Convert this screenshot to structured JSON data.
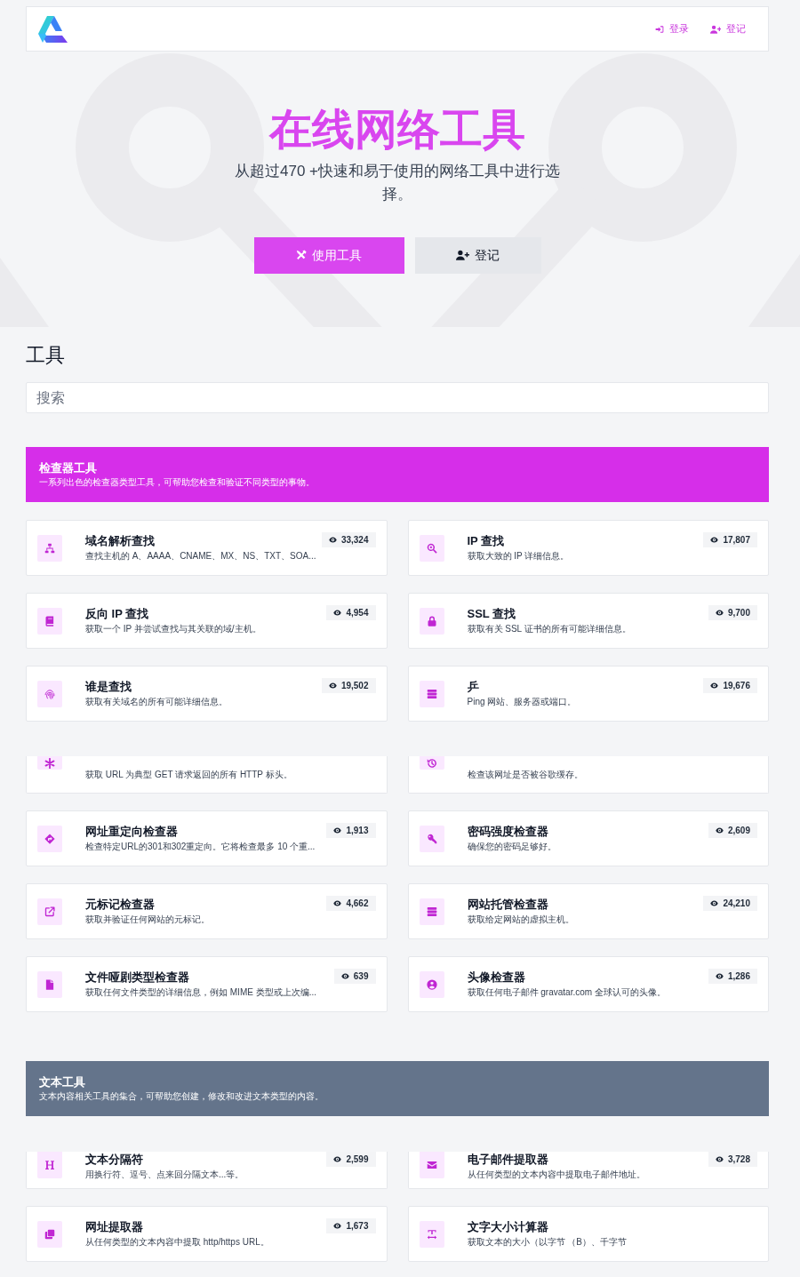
{
  "navbar": {
    "links": [
      {
        "label": "登录"
      },
      {
        "label": "登记"
      }
    ]
  },
  "hero": {
    "title": "在线网络工具",
    "subtitle": "从超过470 +快速和易于使用的网络工具中进行选择。",
    "buttons": [
      {
        "label": "使用工具",
        "kind": "primary"
      },
      {
        "label": "登记",
        "kind": "secondary"
      }
    ]
  },
  "tools": {
    "heading": "工具",
    "search": {
      "placeholder": "搜索"
    }
  },
  "categories": [
    {
      "title": "检查器工具",
      "description": "一系列出色的检查器类型工具，可帮助您检查和验证不同类型的事物。",
      "color": "#d62ee9",
      "tools": [
        {
          "title": "域名解析查找",
          "description": "查找主机的 A、AAAA、CNAME、MX、NS、TXT、SOA...",
          "views": "33,324",
          "cut_top": false
        },
        {
          "title": "IP 查找",
          "description": "获取大致的 IP 详细信息。",
          "views": "17,807",
          "cut_top": false
        },
        {
          "title": "反向 IP 查找",
          "description": "获取一个 IP 并尝试查找与其关联的域/主机。",
          "views": "4,954",
          "cut_top": false
        },
        {
          "title": "SSL 查找",
          "description": "获取有关 SSL 证书的所有可能详细信息。",
          "views": "9,700",
          "cut_top": false
        },
        {
          "title": "谁是查找",
          "description": "获取有关域名的所有可能详细信息。",
          "views": "19,502",
          "cut_top": false
        },
        {
          "title": "乒",
          "description": "Ping 网站、服务器或端口。",
          "views": "19,676",
          "cut_top": false
        },
        {
          "description": "获取 URL 为典型 GET 请求返回的所有 HTTP 标头。",
          "cut_top": true
        },
        {
          "description": "检查该网址是否被谷歌缓存。",
          "cut_top": true
        },
        {
          "title": "网址重定向检查器",
          "description": "检查特定URL的301和302重定向。它将检查最多 10 个重...",
          "views": "1,913",
          "cut_top": false
        },
        {
          "title": "密码强度检查器",
          "description": "确保您的密码足够好。",
          "views": "2,609",
          "cut_top": false
        },
        {
          "title": "元标记检查器",
          "description": "获取并验证任何网站的元标记。",
          "views": "4,662",
          "cut_top": false
        },
        {
          "title": "网站托管检查器",
          "description": "获取给定网站的虚拟主机。",
          "views": "24,210",
          "cut_top": false
        },
        {
          "title": "文件哑剧类型检查器",
          "description": "获取任何文件类型的详细信息，例如 MIME 类型或上次编...",
          "views": "639",
          "cut_top": false
        },
        {
          "title": "头像检查器",
          "description": "获取任何电子邮件 gravatar.com 全球认可的头像。",
          "views": "1,286",
          "cut_top": false
        }
      ]
    },
    {
      "title": "文本工具",
      "description": "文本内容相关工具的集合，可帮助您创建，修改和改进文本类型的内容。",
      "color": "#64748b",
      "tools": [
        {
          "title": "文本分隔符",
          "description": "用换行符、逗号、点来回分隔文本...等。",
          "views": "2,599",
          "cut_top": true
        },
        {
          "title": "电子邮件提取器",
          "description": "从任何类型的文本内容中提取电子邮件地址。",
          "views": "3,728",
          "cut_top": true
        },
        {
          "title": "网址提取器",
          "description": "从任何类型的文本内容中提取 http/https URL。",
          "views": "1,673",
          "cut_top": false
        },
        {
          "title": "文字大小计算器",
          "description": "获取文本的大小（以字节 （B）、千字节",
          "cut_top": false
        }
      ]
    }
  ]
}
